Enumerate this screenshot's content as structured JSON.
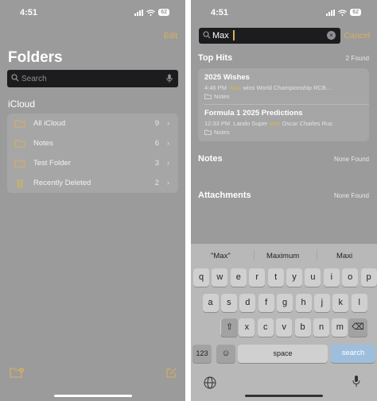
{
  "left": {
    "status_time": "4:51",
    "battery": "62",
    "edit": "Edit",
    "title": "Folders",
    "search_placeholder": "Search",
    "section": "iCloud",
    "folders": [
      {
        "label": "All iCloud",
        "count": "9",
        "icon": "folder-icon"
      },
      {
        "label": "Notes",
        "count": "6",
        "icon": "folder-icon"
      },
      {
        "label": "Test Folder",
        "count": "3",
        "icon": "folder-icon"
      },
      {
        "label": "Recently Deleted",
        "count": "2",
        "icon": "trash-icon"
      }
    ]
  },
  "right": {
    "status_time": "4:51",
    "battery": "62",
    "search_value": "Max",
    "cancel": "Cancel",
    "top_hits": {
      "header": "Top Hits",
      "count": "2 Found",
      "items": [
        {
          "title": "2025 Wishes",
          "time": "4:46 PM",
          "before": "",
          "highlight": "Max",
          "after": " wins World Championship RCB...",
          "folder": "Notes"
        },
        {
          "title": "Formula 1 2025 Predictions",
          "time": "12:33 PM",
          "before": "Lando Super ",
          "highlight": "Max",
          "after": " Oscar Charles Rus",
          "folder": "Notes"
        }
      ]
    },
    "notes": {
      "header": "Notes",
      "status": "None Found"
    },
    "attachments": {
      "header": "Attachments",
      "status": "None Found"
    },
    "keyboard": {
      "predictions": [
        "\"Max\"",
        "Maximum",
        "Maxi"
      ],
      "rows": [
        [
          "q",
          "w",
          "e",
          "r",
          "t",
          "y",
          "u",
          "i",
          "o",
          "p"
        ],
        [
          "a",
          "s",
          "d",
          "f",
          "g",
          "h",
          "j",
          "k",
          "l"
        ],
        [
          "z",
          "x",
          "c",
          "v",
          "b",
          "n",
          "m"
        ]
      ],
      "numbers": "123",
      "space": "space",
      "search": "search"
    }
  },
  "colors": {
    "accent": "#d8b25a",
    "background": "#9b9b9b",
    "searchbar": "#1c1c1e",
    "card": "#a6a6a6"
  }
}
